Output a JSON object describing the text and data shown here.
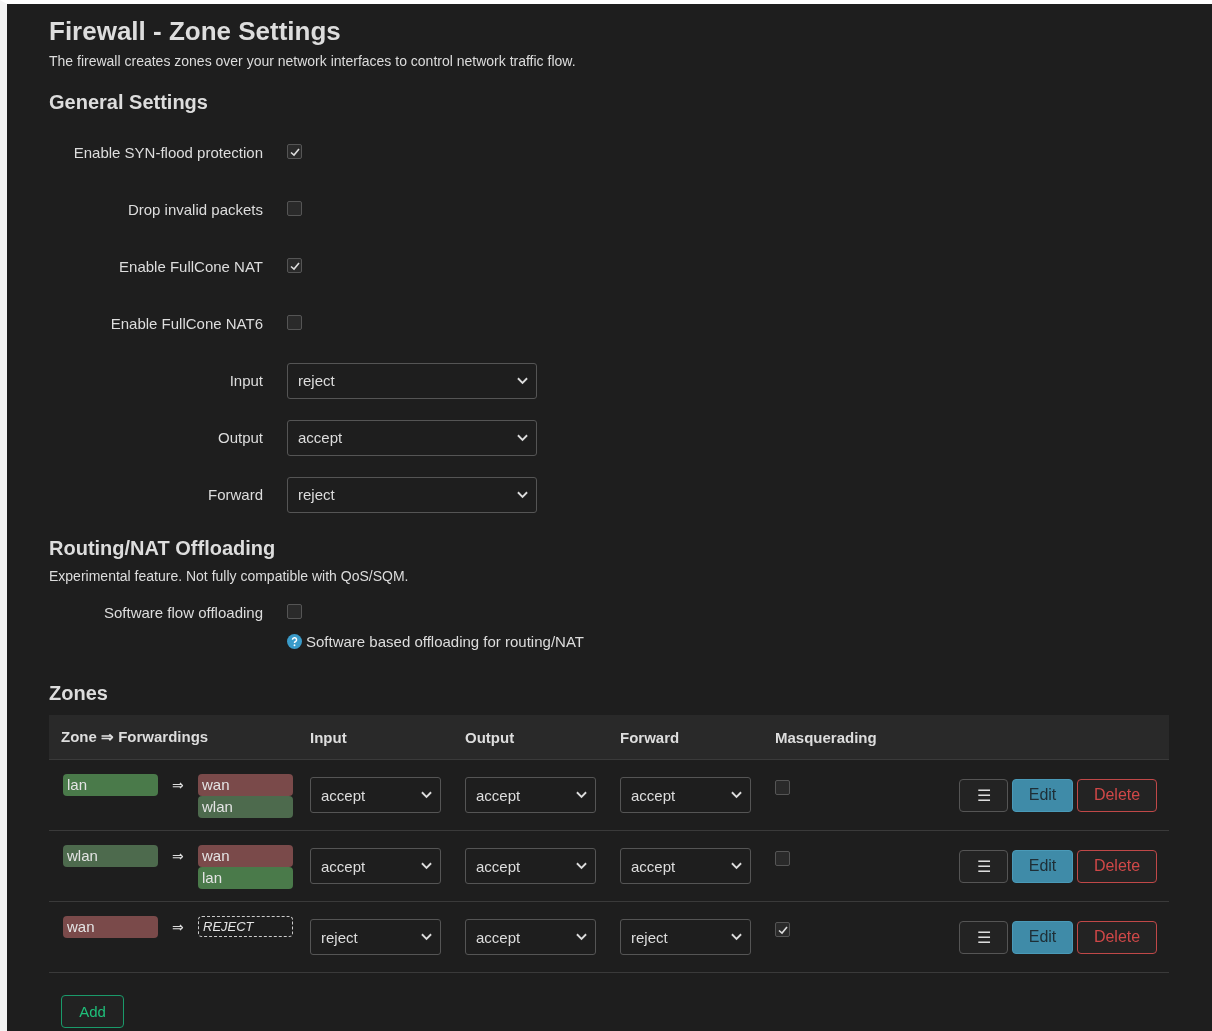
{
  "page": {
    "title": "Firewall - Zone Settings",
    "description": "The firewall creates zones over your network interfaces to control network traffic flow."
  },
  "general": {
    "heading": "General Settings",
    "fields": [
      {
        "kind": "checkbox",
        "label": "Enable SYN-flood protection",
        "checked": true
      },
      {
        "kind": "checkbox",
        "label": "Drop invalid packets",
        "checked": false
      },
      {
        "kind": "checkbox",
        "label": "Enable FullCone NAT",
        "checked": true
      },
      {
        "kind": "checkbox",
        "label": "Enable FullCone NAT6",
        "checked": false
      },
      {
        "kind": "select",
        "label": "Input",
        "value": "reject"
      },
      {
        "kind": "select",
        "label": "Output",
        "value": "accept"
      },
      {
        "kind": "select",
        "label": "Forward",
        "value": "reject"
      }
    ]
  },
  "offloading": {
    "heading": "Routing/NAT Offloading",
    "description": "Experimental feature. Not fully compatible with QoS/SQM.",
    "fields": [
      {
        "kind": "checkbox",
        "label": "Software flow offloading",
        "checked": false,
        "hint": "Software based offloading for routing/NAT"
      }
    ]
  },
  "zones": {
    "heading": "Zones",
    "columns": [
      "Zone ⇒ Forwardings",
      "Input",
      "Output",
      "Forward",
      "Masquerading"
    ],
    "rows": [
      {
        "zone": {
          "name": "lan",
          "color": "#4a7a4a"
        },
        "arrow": "⇒",
        "forwardings": [
          {
            "kind": "zone",
            "name": "wan",
            "color": "#7a4a4a"
          },
          {
            "kind": "zone",
            "name": "wlan",
            "color": "#4d6a4d"
          }
        ],
        "input": "accept",
        "output": "accept",
        "forward": "accept",
        "masquerading": false,
        "menu": "☰",
        "edit": "Edit",
        "delete": "Delete"
      },
      {
        "zone": {
          "name": "wlan",
          "color": "#4d6a4d"
        },
        "arrow": "⇒",
        "forwardings": [
          {
            "kind": "zone",
            "name": "wan",
            "color": "#7a4a4a"
          },
          {
            "kind": "zone",
            "name": "lan",
            "color": "#4a7a4a"
          }
        ],
        "input": "accept",
        "output": "accept",
        "forward": "accept",
        "masquerading": false,
        "menu": "☰",
        "edit": "Edit",
        "delete": "Delete"
      },
      {
        "zone": {
          "name": "wan",
          "color": "#7a4a4a"
        },
        "arrow": "⇒",
        "forwardings": [
          {
            "kind": "policy",
            "name": "REJECT"
          }
        ],
        "input": "reject",
        "output": "accept",
        "forward": "reject",
        "masquerading": true,
        "menu": "☰",
        "edit": "Edit",
        "delete": "Delete"
      }
    ],
    "add": "Add"
  }
}
